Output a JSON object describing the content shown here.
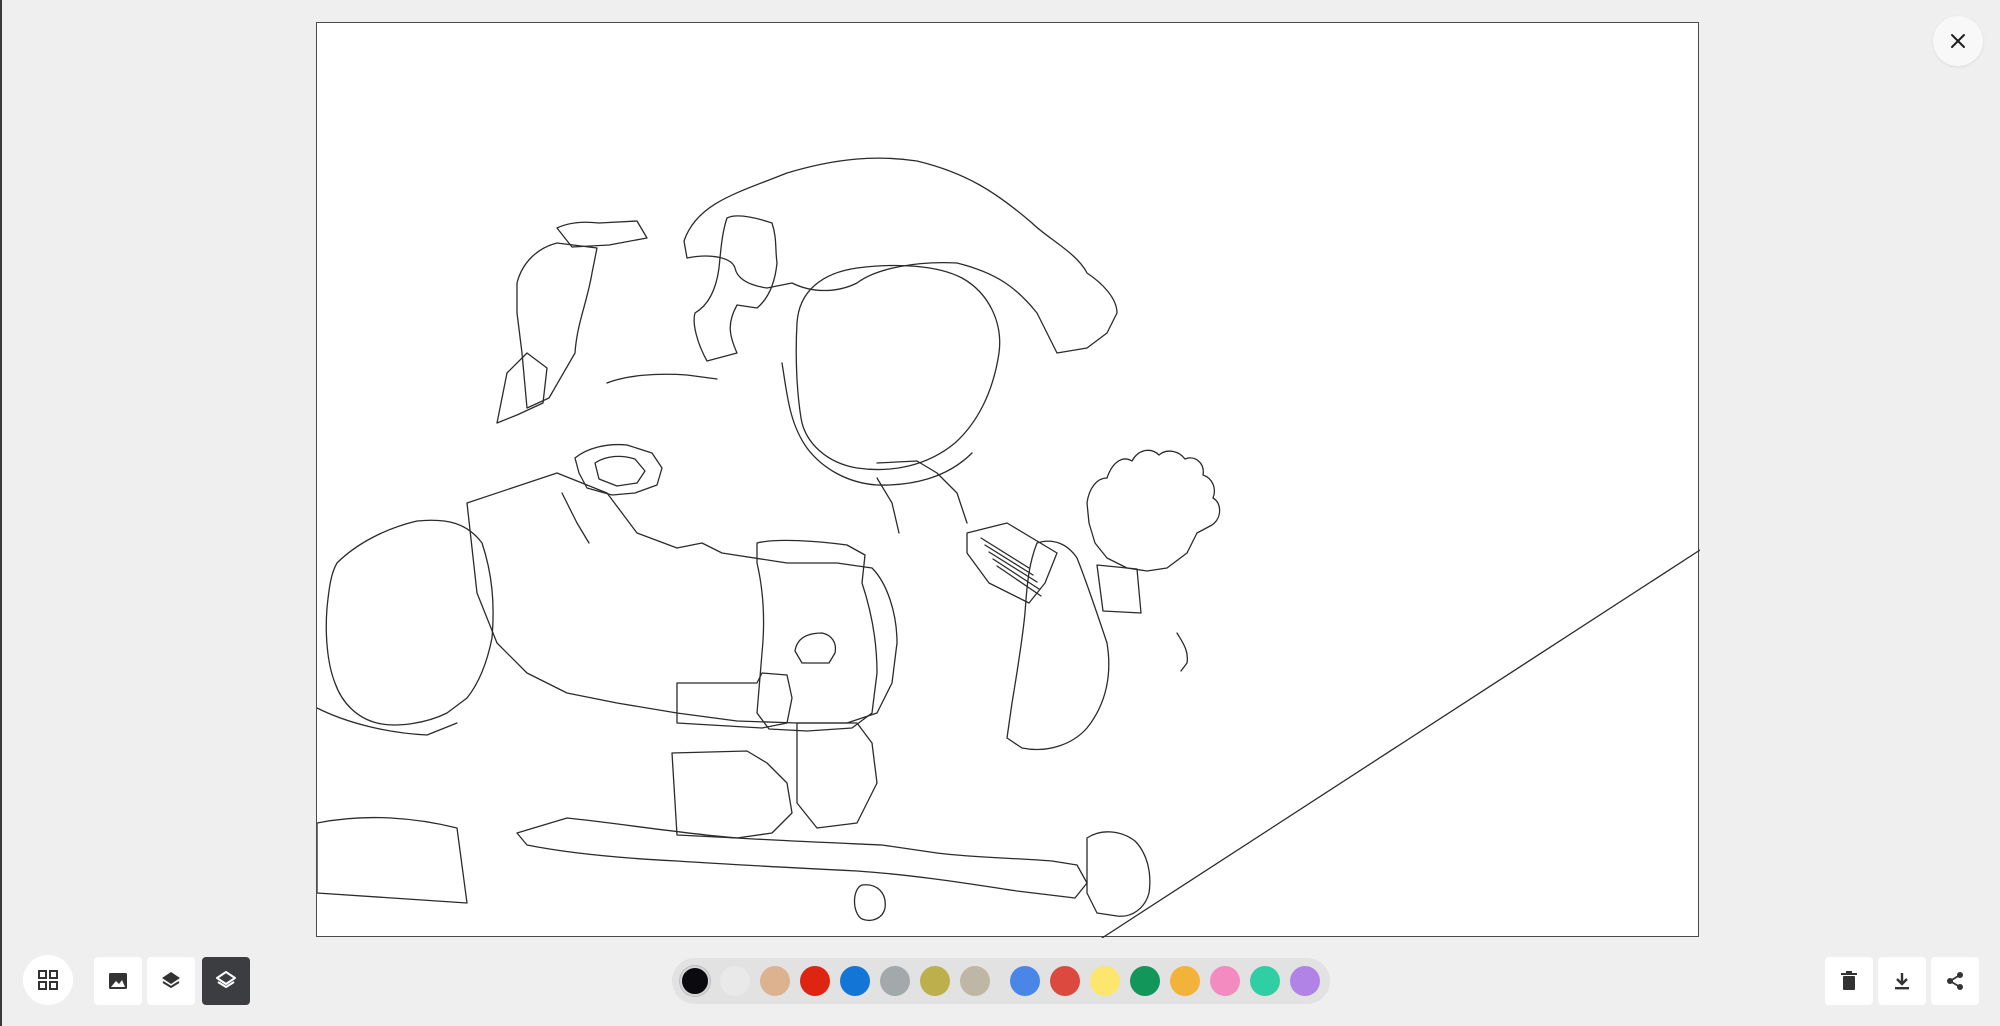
{
  "toolbar_left": {
    "gallery_icon": "grid-icon",
    "image_icon": "image-icon",
    "layers_icon": "layers-icon",
    "layers_outline_icon": "layers-outline-icon"
  },
  "toolbar_right": {
    "delete_icon": "trash-icon",
    "download_icon": "download-icon",
    "share_icon": "share-icon"
  },
  "close_icon": "close-icon",
  "palette": {
    "selected_index": 0,
    "colors": [
      "#0b0b0f",
      "#e9e9e9",
      "#ddb38f",
      "#dd2512",
      "#1376d6",
      "#a3a8ab",
      "#bdb04c",
      "#bfb7a6",
      "#4a86e8",
      "#dc4a3f",
      "#fde66d",
      "#12965a",
      "#f3b23a",
      "#f38bc1",
      "#30cfa3",
      "#b283e6"
    ]
  },
  "canvas": {
    "image_subject": "astronaut-line-art"
  }
}
